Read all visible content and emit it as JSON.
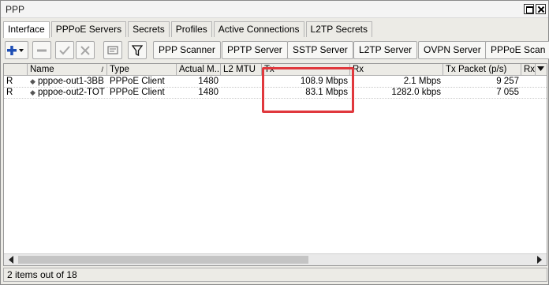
{
  "window": {
    "title": "PPP"
  },
  "tabs": [
    "Interface",
    "PPPoE Servers",
    "Secrets",
    "Profiles",
    "Active Connections",
    "L2TP Secrets"
  ],
  "toolbar": {
    "icons": [
      "add-dropdown-icon",
      "remove-icon",
      "enable-icon",
      "disable-icon",
      "comment-icon",
      "filter-icon"
    ],
    "buttons": [
      "PPP Scanner",
      "PPTP Server",
      "SSTP Server",
      "L2TP Server",
      "OVPN Server",
      "PPPoE Scan"
    ]
  },
  "columns": {
    "flag": "",
    "name": "Name",
    "type": "Type",
    "actual_mtu": "Actual M...",
    "l2_mtu": "L2 MTU",
    "tx": "Tx",
    "rx": "Rx",
    "tx_packet": "Tx Packet (p/s)",
    "rx_packet": "Rx"
  },
  "rows": [
    {
      "flag": "R",
      "name": "pppoe-out1-3BB",
      "type": "PPPoE Client",
      "actual_mtu": "1480",
      "l2_mtu": "",
      "tx": "108.9 Mbps",
      "rx": "2.1 Mbps",
      "tx_packet": "9 257"
    },
    {
      "flag": "R",
      "name": "pppoe-out2-TOT",
      "type": "PPPoE Client",
      "actual_mtu": "1480",
      "l2_mtu": "",
      "tx": "83.1 Mbps",
      "rx": "1282.0 kbps",
      "tx_packet": "7 055"
    }
  ],
  "status": {
    "text": "2 items out of 18"
  },
  "colors": {
    "highlight": "#e0383d",
    "add_icon": "#1f4fb5"
  }
}
